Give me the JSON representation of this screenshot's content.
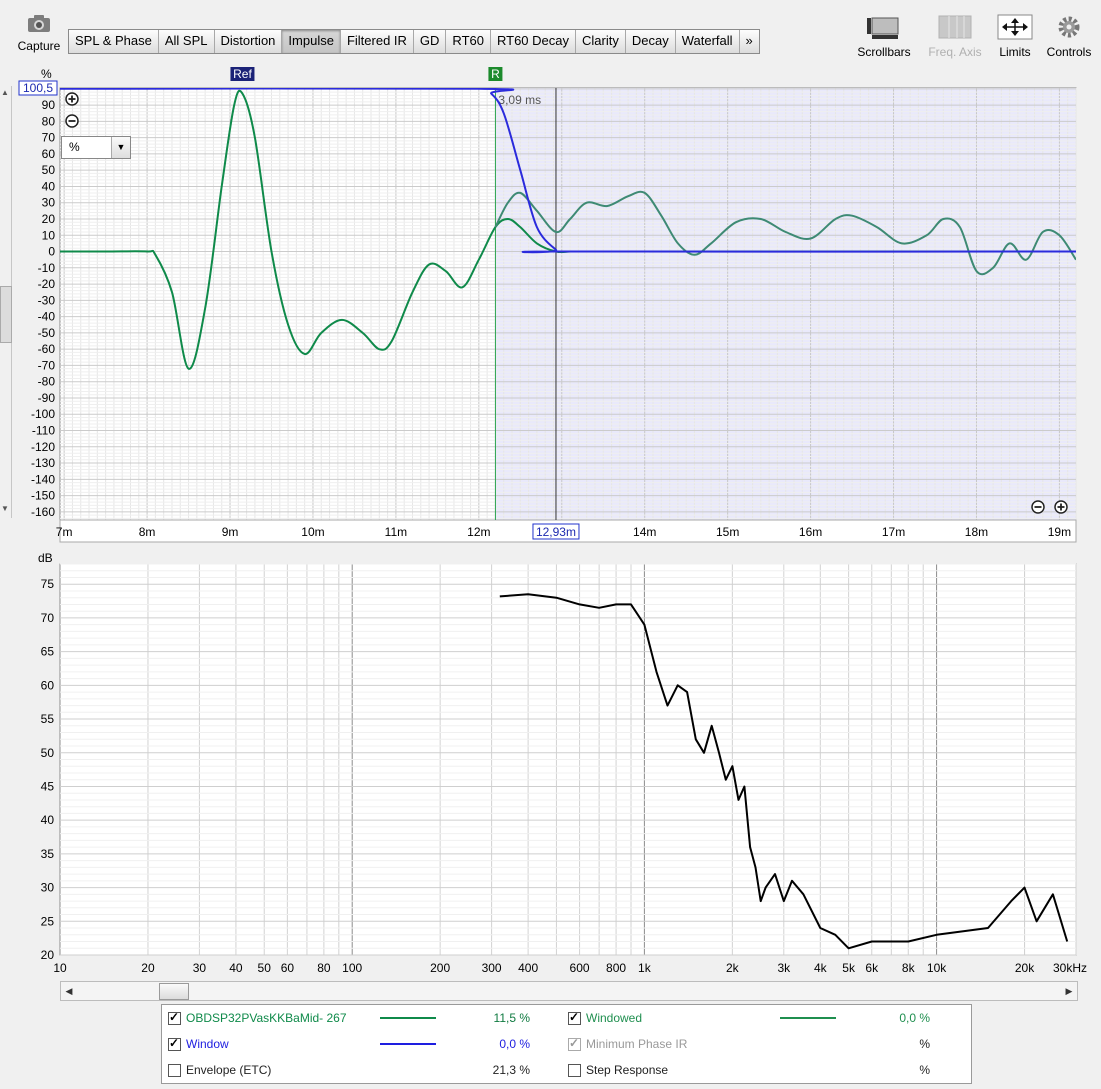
{
  "toolbar": {
    "capture_label": "Capture",
    "tabs": [
      {
        "label": "SPL & Phase"
      },
      {
        "label": "All SPL"
      },
      {
        "label": "Distortion"
      },
      {
        "label": "Impulse"
      },
      {
        "label": "Filtered IR"
      },
      {
        "label": "GD"
      },
      {
        "label": "RT60"
      },
      {
        "label": "RT60 Decay"
      },
      {
        "label": "Clarity"
      },
      {
        "label": "Decay"
      },
      {
        "label": "Waterfall"
      },
      {
        "label": "»"
      }
    ],
    "active_tab": "Impulse",
    "scrollbars_label": "Scrollbars",
    "freq_axis_label": "Freq. Axis",
    "limits_label": "Limits",
    "controls_label": "Controls"
  },
  "impulse_plot": {
    "y_unit": "%",
    "top_value_label": "100,5",
    "unit_select_value": "%",
    "ref_marker_label": "Ref",
    "r_marker_label": "R",
    "window_duration_label": "3,09 ms",
    "cursor_label": "12,93m",
    "y_ticks": [
      "90",
      "80",
      "70",
      "60",
      "50",
      "40",
      "30",
      "20",
      "10",
      "0",
      "-10",
      "-20",
      "-30",
      "-40",
      "-50",
      "-60",
      "-70",
      "-80",
      "-90",
      "-100",
      "-110",
      "-120",
      "-130",
      "-140",
      "-150",
      "-160"
    ],
    "x_ticks": [
      "7m",
      "8m",
      "9m",
      "10m",
      "11m",
      "12m",
      "14m",
      "15m",
      "16m",
      "17m",
      "18m",
      "19m"
    ]
  },
  "spl_plot": {
    "y_unit": "dB",
    "y_ticks": [
      "75",
      "70",
      "65",
      "60",
      "55",
      "50",
      "45",
      "40",
      "35",
      "30",
      "25",
      "20"
    ],
    "x_ticks": [
      "10",
      "20",
      "30",
      "40",
      "50",
      "60",
      "80",
      "100",
      "200",
      "300",
      "400",
      "600",
      "800",
      "1k",
      "2k",
      "3k",
      "4k",
      "5k",
      "6k",
      "8k",
      "10k",
      "20k",
      "30kHz"
    ]
  },
  "chart_data": [
    {
      "type": "line",
      "ylabel": "%",
      "xlim": [
        6.95,
        19.2
      ],
      "ylim": [
        -165,
        100.5
      ],
      "grid": true,
      "series": [
        {
          "name": "OBDSP32PVasKKBaMid- 267",
          "color": "#0f8a4a",
          "x": [
            6.95,
            7.5,
            8.0,
            8.1,
            8.3,
            8.5,
            8.7,
            8.9,
            9.05,
            9.15,
            9.3,
            9.5,
            9.7,
            9.9,
            10.1,
            10.35,
            10.6,
            10.8,
            10.95,
            11.2,
            11.4,
            11.6,
            11.8,
            12.0,
            12.2,
            12.35,
            12.5,
            12.7,
            12.93,
            13.1,
            13.3,
            13.55,
            13.8,
            14.0,
            14.2,
            14.4,
            14.6,
            14.8,
            15.1,
            15.4,
            15.7,
            16.0,
            16.3,
            16.5,
            16.8,
            17.1,
            17.4,
            17.6,
            17.8,
            18.0,
            18.2,
            18.4,
            18.6,
            18.8,
            19.0,
            19.2
          ],
          "y": [
            0,
            0,
            0,
            -2,
            -25,
            -72,
            -35,
            40,
            90,
            97,
            70,
            0,
            -45,
            -63,
            -50,
            -42,
            -50,
            -60,
            -55,
            -25,
            -8,
            -12,
            -22,
            -5,
            15,
            20,
            15,
            5,
            0,
            0,
            0,
            0,
            0,
            0,
            0,
            0,
            0,
            0,
            0,
            0,
            0,
            0,
            0,
            0,
            0,
            0,
            0,
            0,
            0,
            0,
            0,
            0,
            0,
            0,
            0,
            0
          ]
        },
        {
          "name": "Windowed",
          "color": "#3e8a74",
          "x": [
            12.2,
            12.35,
            12.5,
            12.7,
            12.93,
            13.1,
            13.3,
            13.55,
            13.8,
            14.0,
            14.2,
            14.4,
            14.6,
            14.8,
            15.1,
            15.4,
            15.7,
            16.0,
            16.3,
            16.5,
            16.8,
            17.1,
            17.4,
            17.6,
            17.8,
            18.0,
            18.2,
            18.4,
            18.6,
            18.8,
            19.0,
            19.2
          ],
          "y": [
            15,
            30,
            36,
            25,
            12,
            20,
            30,
            28,
            34,
            36,
            22,
            5,
            -2,
            5,
            18,
            20,
            12,
            8,
            20,
            22,
            15,
            5,
            10,
            20,
            15,
            -12,
            -10,
            5,
            -5,
            12,
            10,
            -5
          ]
        },
        {
          "name": "Window",
          "color": "#2b2bdc",
          "x": [
            6.95,
            12.0,
            12.15,
            12.3,
            12.5,
            12.7,
            12.93,
            13.0,
            19.2
          ],
          "y": [
            100,
            100,
            97,
            85,
            50,
            15,
            1,
            0,
            0
          ]
        }
      ]
    },
    {
      "type": "line",
      "xlabel": "Hz",
      "ylabel": "dB",
      "xlim": [
        10,
        30000
      ],
      "ylim": [
        20,
        78
      ],
      "x_scale": "log",
      "grid": true,
      "series": [
        {
          "name": "OBDSP32PVasKKBaMid- 267",
          "color": "#000000",
          "x": [
            320,
            400,
            500,
            600,
            700,
            800,
            900,
            1000,
            1100,
            1200,
            1300,
            1400,
            1500,
            1600,
            1700,
            1800,
            1900,
            2000,
            2100,
            2200,
            2300,
            2400,
            2500,
            2600,
            2800,
            3000,
            3200,
            3500,
            4000,
            4500,
            5000,
            6000,
            8000,
            10000,
            15000,
            18000,
            20000,
            22000,
            25000,
            28000
          ],
          "y": [
            73.2,
            73.5,
            73,
            72,
            71.5,
            72,
            72,
            69,
            62,
            57,
            60,
            59,
            52,
            50,
            54,
            50,
            46,
            48,
            43,
            45,
            36,
            33,
            28,
            30,
            32,
            28,
            31,
            29,
            24,
            23,
            21,
            22,
            22,
            23,
            24,
            28,
            30,
            25,
            29,
            22
          ]
        }
      ]
    }
  ],
  "legend": {
    "items": [
      {
        "label": "OBDSP32PVasKKBaMid- 267",
        "value": "11,5 %",
        "checked": true,
        "color": "#0f8a4a",
        "enabled": true
      },
      {
        "label": "Windowed",
        "value": "0,0 %",
        "checked": true,
        "color": "#1f8f4f",
        "enabled": true
      },
      {
        "label": "Window",
        "value": "0,0 %",
        "checked": true,
        "color": "#1e1ee0",
        "enabled": true
      },
      {
        "label": "Minimum Phase IR",
        "value": "%",
        "checked": true,
        "color": "#909090",
        "enabled": false
      },
      {
        "label": "Envelope (ETC)",
        "value": "21,3 %",
        "checked": false,
        "color": "#000000",
        "enabled": true
      },
      {
        "label": "Step Response",
        "value": "%",
        "checked": false,
        "color": "#000000",
        "enabled": true
      }
    ]
  }
}
